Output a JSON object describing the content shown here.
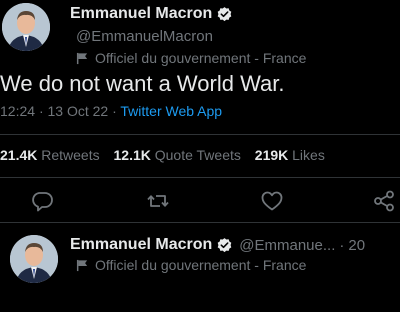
{
  "tweet": {
    "author_name": "Emmanuel Macron",
    "handle": "@EmmanuelMacron",
    "affiliation": "Officiel du gouvernement - France",
    "text": "We do not want a World War.",
    "time": "12:24",
    "date": "13 Oct 22",
    "separator": "·",
    "source": "Twitter Web App",
    "retweets_count": "21.4K",
    "retweets_label": "Retweets",
    "quotes_count": "12.1K",
    "quotes_label": "Quote Tweets",
    "likes_count": "219K",
    "likes_label": "Likes"
  },
  "actions": {
    "reply_icon": "reply-icon",
    "retweet_icon": "retweet-icon",
    "like_icon": "heart-icon",
    "share_icon": "share-icon"
  },
  "reply": {
    "author_name": "Emmanuel Macron",
    "handle": "@Emmanue...",
    "separator": "·",
    "date": "20",
    "affiliation": "Officiel du gouvernement - France"
  },
  "colors": {
    "background": "#000000",
    "text": "#e7e9ea",
    "secondary": "#71767b",
    "link": "#1d9bf0",
    "verified": "#e7e9ea"
  }
}
